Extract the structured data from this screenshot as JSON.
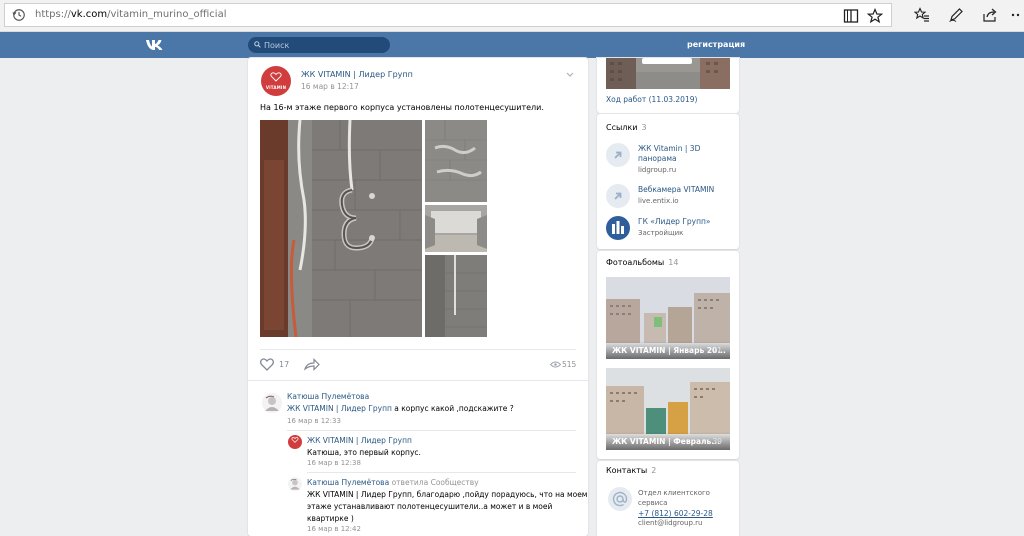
{
  "browser": {
    "url_prefix": "https://",
    "url_domain": "vk.com",
    "url_path": "/vitamin_murino_official"
  },
  "vk_header": {
    "search_placeholder": "Поиск",
    "register_label": "регистрация"
  },
  "post": {
    "author": "ЖК VITAMIN | Лидер Групп",
    "avatar_text": "VITAMIN",
    "date": "16 мар в 12:17",
    "text": "На 16-м этаже первого корпуса установлены полотенцесушители.",
    "likes": "17",
    "views": "515"
  },
  "comments": [
    {
      "author": "Катюша Пулемётова",
      "reply_to": "ЖК VITAMIN | Лидер Групп",
      "text": " а корпус какой ,подскажите ?",
      "date": "16 мар в 12:33"
    },
    {
      "author": "ЖК VITAMIN | Лидер Групп",
      "text": "Катюша, это первый корпус.",
      "date": "16 мар в 12:38"
    },
    {
      "author": "Катюша Пулемётова",
      "author_suffix": " ответила Сообществу",
      "text_line1": "ЖК VITAMIN | Лидер Групп, благодарю ,пойду порадуюсь, что на моем",
      "text_line2": "этаже устанавливают полотенцесушители..а может и в моей",
      "text_line3": "квартирке )",
      "date": "16 мар в 12:42"
    }
  ],
  "sidebar": {
    "progress_caption": "Ход работ (11.03.2019)",
    "links_title": "Ссылки",
    "links_count": "3",
    "links": [
      {
        "name_line1": "ЖК Vitamin | 3D",
        "name_line2": "панорама",
        "sub": "lidgroup.ru"
      },
      {
        "name_line1": "Вебкамера VITAMIN",
        "sub": "live.entix.io"
      },
      {
        "name_line1": "ГК «Лидер Групп»",
        "sub": "Застройщик"
      }
    ],
    "albums_title": "Фотоальбомы",
    "albums_count": "14",
    "albums": [
      {
        "title": "ЖК VITAMIN | Январь 20...",
        "count": "21"
      },
      {
        "title": "ЖК VITAMIN | Февраль...",
        "count": "39"
      }
    ],
    "contacts_title": "Контакты",
    "contacts_count": "2",
    "contact": {
      "line1": "Отдел клиентского",
      "line2": "сервиса",
      "phone": "+7 (812) 602-29-28",
      "email": "client@lidgroup.ru"
    }
  }
}
